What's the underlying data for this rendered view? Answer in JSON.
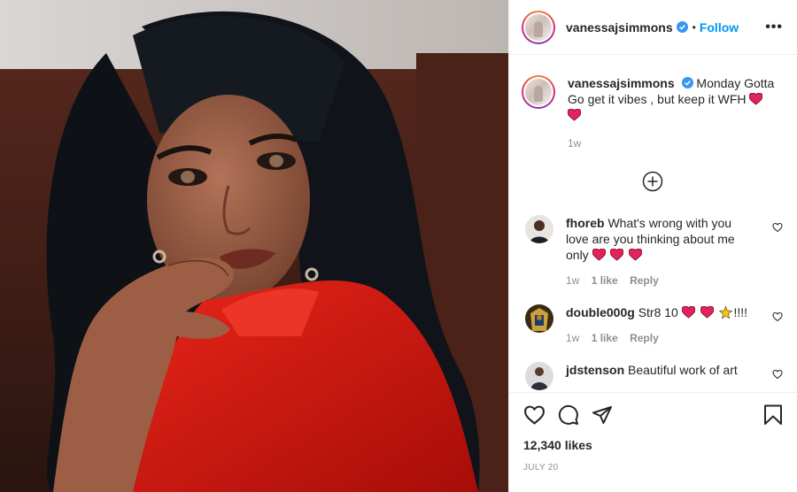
{
  "post": {
    "username": "vanessajsimmons",
    "dot": "•",
    "follow_label": "Follow",
    "more_label": "•••"
  },
  "caption": {
    "username": "vanessajsimmons",
    "text": "Monday Gotta Go get it vibes , but keep it WFH",
    "emoji": [
      "red-heart",
      "red-heart"
    ],
    "time": "1w"
  },
  "load_more_icon": "plus-circle-icon",
  "comments": [
    {
      "username": "fhoreb",
      "text": "What's wrong with you love are you thinking about me only",
      "emoji": [
        "red-heart",
        "red-heart",
        "red-heart"
      ],
      "time": "1w",
      "likes": "1 like",
      "reply": "Reply"
    },
    {
      "username": "double000g",
      "text": "Str8 10",
      "emoji": [
        "red-heart",
        "red-heart",
        "sparkle-star"
      ],
      "suffix": "!!!!",
      "time": "1w",
      "likes": "1 like",
      "reply": "Reply"
    },
    {
      "username": "jdstenson",
      "text": "Beautiful work of art"
    }
  ],
  "likes_count": "12,340 likes",
  "date": "JULY 20",
  "colors": {
    "accent": "#0095f6",
    "muted": "#8e8e8e",
    "heart": "#e0245e",
    "dress": "#d4160f"
  }
}
